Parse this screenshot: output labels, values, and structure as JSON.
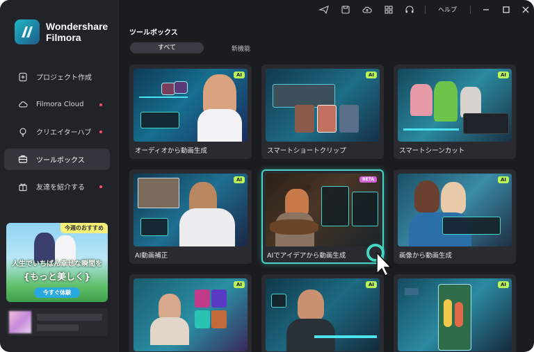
{
  "app": {
    "brand_line1": "Wondershare",
    "brand_line2": "Filmora"
  },
  "sidebar": {
    "items": [
      {
        "label": "プロジェクト作成",
        "icon": "new-project-icon",
        "active": false,
        "dot": false
      },
      {
        "label": "Filmora Cloud",
        "icon": "cloud-icon",
        "active": false,
        "dot": true
      },
      {
        "label": "クリエイターハブ",
        "icon": "lightbulb-icon",
        "active": false,
        "dot": true
      },
      {
        "label": "ツールボックス",
        "icon": "toolbox-icon",
        "active": true,
        "dot": false
      },
      {
        "label": "友達を紹介する",
        "icon": "gift-icon",
        "active": false,
        "dot": true
      }
    ],
    "promo": {
      "tag": "今週のおすすめ",
      "line1": "人生でいちばん幸せな瞬間を",
      "line2": "{もっと美しく}",
      "button": "今すぐ体験"
    }
  },
  "titlebar": {
    "help": "ヘルプ",
    "icons": [
      "send-icon",
      "save-icon",
      "cloud-upload-icon",
      "grid-icon",
      "headset-icon",
      "minimize-icon",
      "maximize-icon",
      "close-icon"
    ]
  },
  "main": {
    "title": "ツールボックス",
    "tabs": [
      {
        "label": "すべて",
        "active": true
      },
      {
        "label": "新機能",
        "active": false
      }
    ],
    "cards": [
      {
        "label": "オーディオから動画生成",
        "badge": "AI"
      },
      {
        "label": "スマートショートクリップ",
        "badge": "AI"
      },
      {
        "label": "スマートシーンカット",
        "badge": "AI"
      },
      {
        "label": "AI動画補正",
        "badge": "AI"
      },
      {
        "label": "AIでアイデアから動画生成",
        "badge": "BETA"
      },
      {
        "label": "画像から動画生成",
        "badge": "AI"
      },
      {
        "label": "",
        "badge": "AI"
      },
      {
        "label": "",
        "badge": "AI"
      },
      {
        "label": "",
        "badge": "AI"
      }
    ]
  },
  "colors": {
    "accent": "#46d6c4",
    "ai_badge": "#b8f55a",
    "beta_badge": "#d463d9",
    "notify_dot": "#ff4b5c"
  }
}
